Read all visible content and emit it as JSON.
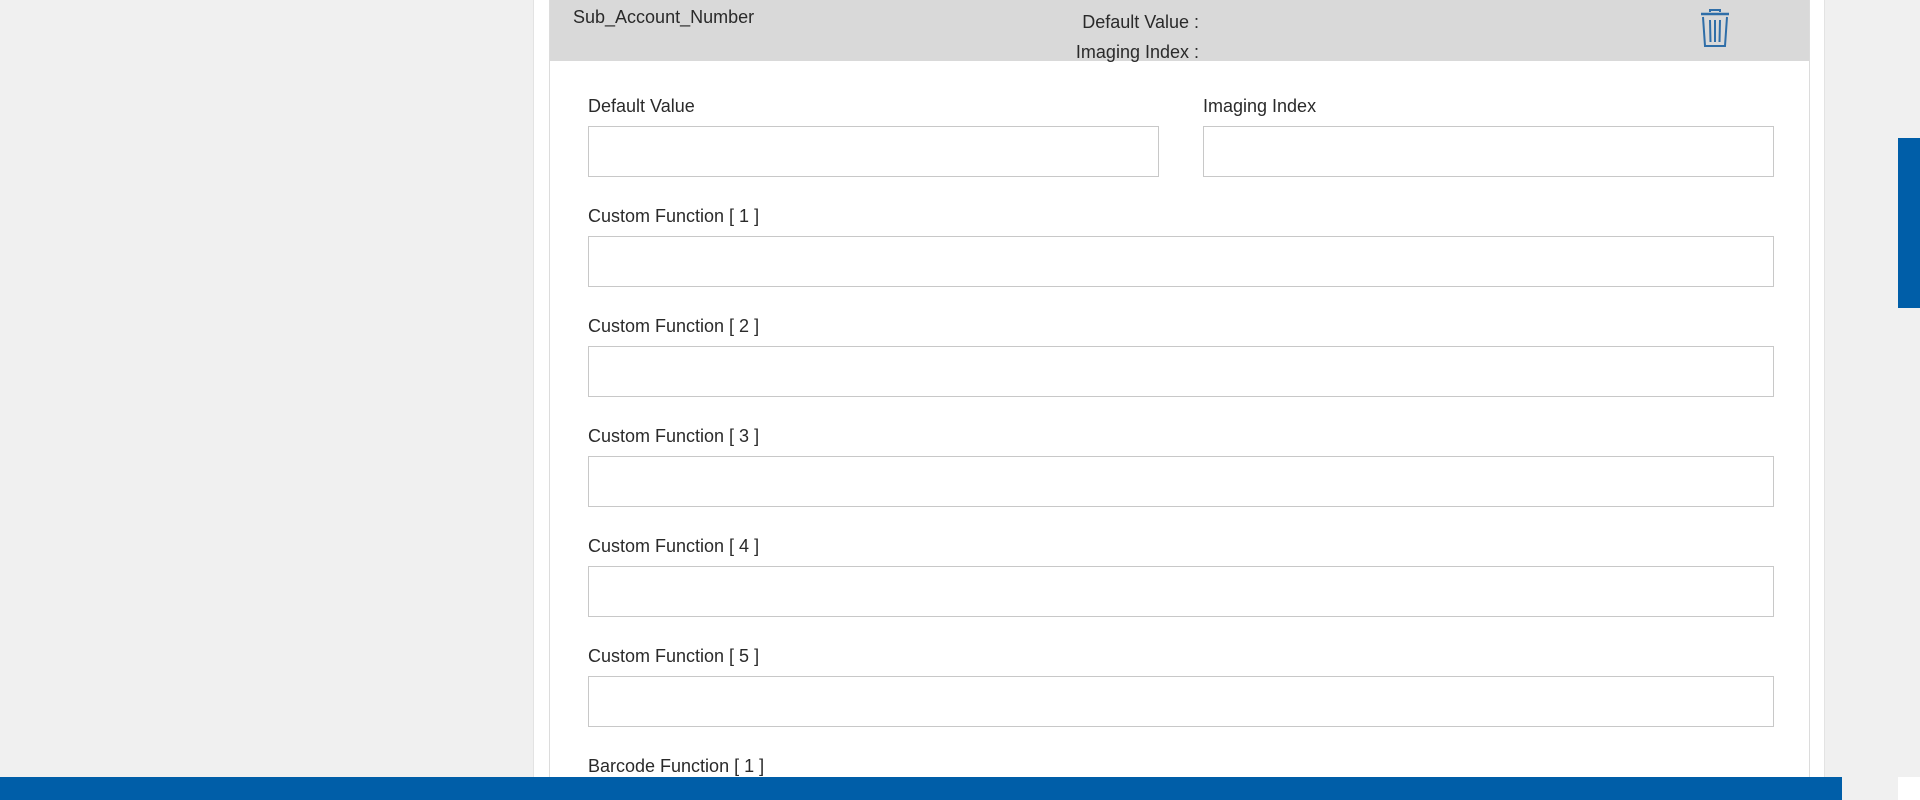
{
  "field_card": {
    "name": "Sub_Account_Number",
    "summary_default_value_label": "Default Value :",
    "summary_imaging_index_label": "Imaging Index :",
    "delete_icon": "trash-icon"
  },
  "form": {
    "default_value": {
      "label": "Default Value",
      "value": ""
    },
    "imaging_index": {
      "label": "Imaging Index",
      "value": ""
    },
    "custom_functions": [
      {
        "label": "Custom Function [ 1 ]",
        "value": ""
      },
      {
        "label": "Custom Function [ 2 ]",
        "value": ""
      },
      {
        "label": "Custom Function [ 3 ]",
        "value": ""
      },
      {
        "label": "Custom Function [ 4 ]",
        "value": ""
      },
      {
        "label": "Custom Function [ 5 ]",
        "value": ""
      }
    ],
    "barcode_function_label": "Barcode Function [ 1 ]"
  },
  "colors": {
    "accent": "#005ea8",
    "header_bg": "#d9d9d9",
    "page_bg": "#f0f0f0"
  }
}
